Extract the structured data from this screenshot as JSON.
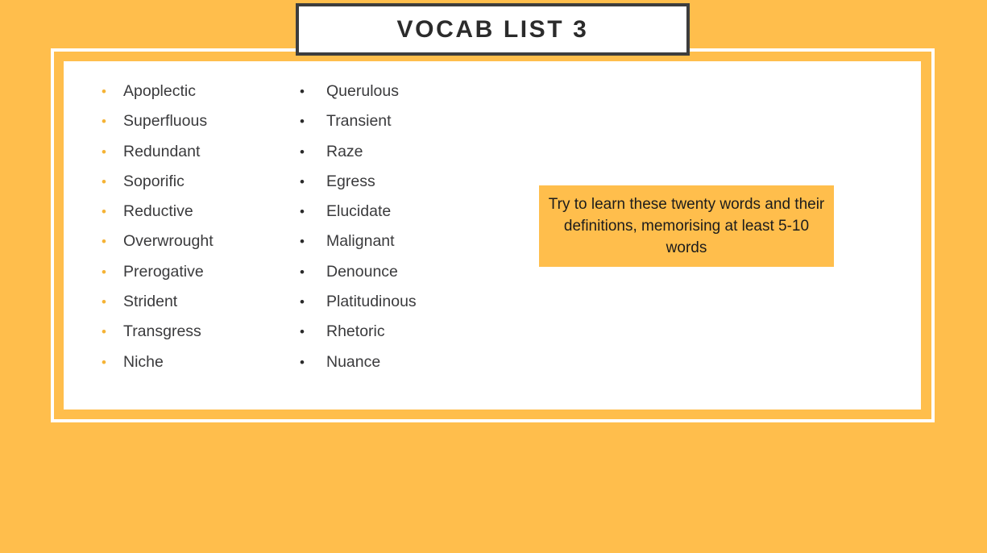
{
  "slide": {
    "title": "VOCAB LIST 3",
    "background_color": "#ffbe4c",
    "panel_color": "#ffffff",
    "title_border_color": "#3d3d3d",
    "accent_bullet_color": "#f5b335",
    "text_color": "#3a3a3c"
  },
  "columns": [
    {
      "bullet_color": "#f5b335",
      "bullet_glyph": "•",
      "words": [
        "Apoplectic",
        "Superfluous",
        "Redundant",
        "Soporific",
        "Reductive",
        "Overwrought",
        "Prerogative",
        "Strident",
        "Transgress",
        "Niche"
      ]
    },
    {
      "bullet_color": "#2b2b2b",
      "bullet_glyph": "•",
      "words": [
        "Querulous",
        "Transient",
        "Raze",
        "Egress",
        "Elucidate",
        "Malignant",
        "Denounce",
        "Platitudinous",
        "Rhetoric",
        "Nuance"
      ]
    }
  ],
  "callout": {
    "text": "Try to learn these twenty words and their definitions, memorising at least 5-10 words",
    "background_color": "#ffbe4c"
  }
}
